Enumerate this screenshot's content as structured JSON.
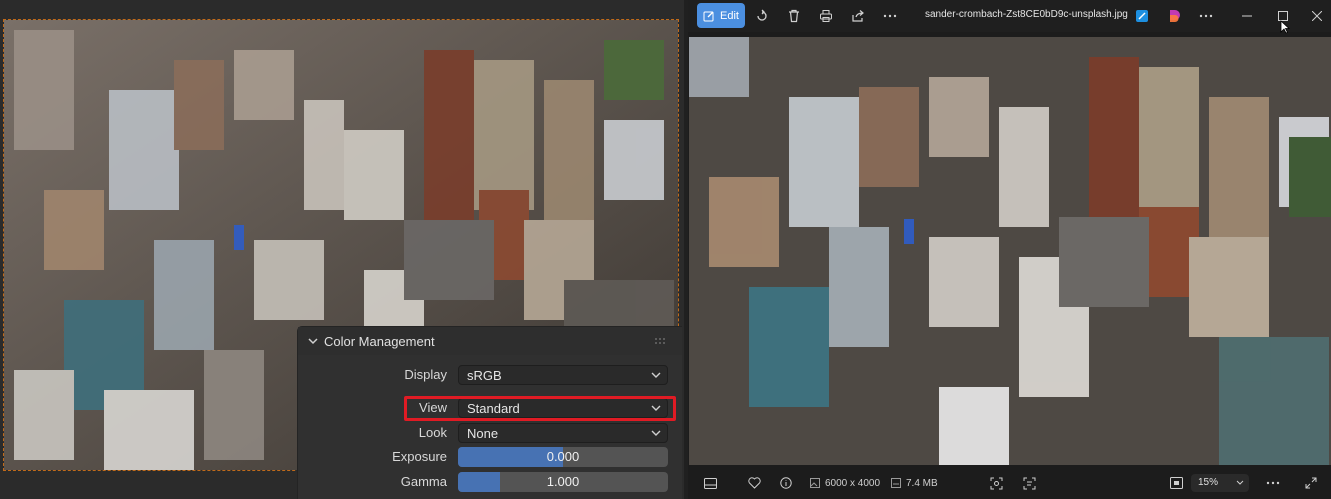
{
  "blender": {
    "color_management": {
      "title": "Color Management",
      "display_label": "Display",
      "display_value": "sRGB",
      "view_label": "View",
      "view_value": "Standard",
      "look_label": "Look",
      "look_value": "None",
      "exposure_label": "Exposure",
      "exposure_value": "0.000",
      "exposure_fill": 0.5,
      "gamma_label": "Gamma",
      "gamma_value": "1.000",
      "gamma_fill": 0.2
    },
    "highlight_color": "#e01b24",
    "frame_border_color": "#c06a1a"
  },
  "photos": {
    "toolbar": {
      "edit_label": "Edit",
      "file_name": "sander-crombach-Zst8CE0bD9c-unsplash.jpg",
      "icons": [
        "edit-icon",
        "rotate-icon",
        "delete-icon",
        "print-icon",
        "share-icon",
        "more-icon",
        "copilot-icon",
        "designer-icon",
        "more-icon",
        "minimize-icon",
        "maximize-icon",
        "close-icon"
      ]
    },
    "status": {
      "dimensions": "6000 x 4000",
      "file_size": "7.4 MB",
      "zoom": "15%"
    },
    "accent_color": "#4b8fe0"
  }
}
